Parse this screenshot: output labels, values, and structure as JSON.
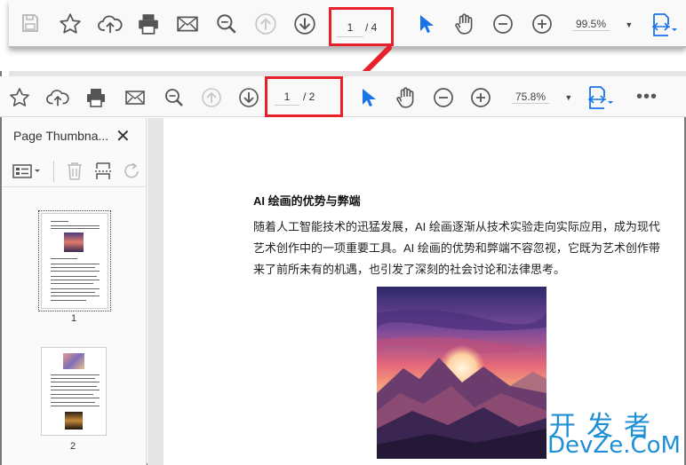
{
  "top_toolbar": {
    "page_current": "1",
    "page_total": "/ 4",
    "zoom": "99.5%"
  },
  "second_toolbar": {
    "page_current": "1",
    "page_total": "/ 2",
    "zoom": "75.8%"
  },
  "sidebar": {
    "title": "Page Thumbna...",
    "thumbnails": [
      {
        "label": "1"
      },
      {
        "label": "2"
      }
    ]
  },
  "document": {
    "heading": "AI 绘画的优势与弊端",
    "paragraph": "随着人工智能技术的迅猛发展，AI 绘画逐渐从技术实验走向实际应用，成为现代艺术创作中的一项重要工具。AI 绘画的优势和弊端不容忽视，它既为艺术创作带来了前所未有的机遇，也引发了深刻的社会讨论和法律思考。"
  },
  "watermark": {
    "cn": "开发者",
    "en": "DevZe.CoM"
  },
  "colors": {
    "highlight_red": "#e8202a",
    "accent_blue": "#1a73e8"
  }
}
